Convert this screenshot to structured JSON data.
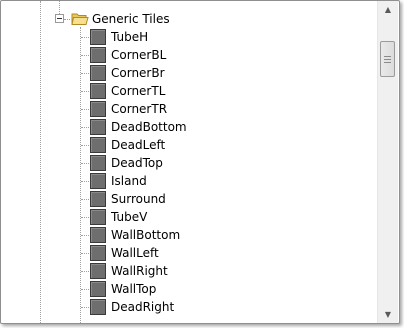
{
  "tree": {
    "root": {
      "label": "Generic Tiles",
      "icon": "folder-open-icon",
      "expanded": true
    },
    "items": [
      {
        "label": "TubeH",
        "icon": "tile-icon"
      },
      {
        "label": "CornerBL",
        "icon": "tile-icon"
      },
      {
        "label": "CornerBr",
        "icon": "tile-icon"
      },
      {
        "label": "CornerTL",
        "icon": "tile-icon"
      },
      {
        "label": "CornerTR",
        "icon": "tile-icon"
      },
      {
        "label": "DeadBottom",
        "icon": "tile-icon"
      },
      {
        "label": "DeadLeft",
        "icon": "tile-icon"
      },
      {
        "label": "DeadTop",
        "icon": "tile-icon"
      },
      {
        "label": "Island",
        "icon": "tile-icon"
      },
      {
        "label": "Surround",
        "icon": "tile-icon"
      },
      {
        "label": "TubeV",
        "icon": "tile-icon"
      },
      {
        "label": "WallBottom",
        "icon": "tile-icon"
      },
      {
        "label": "WallLeft",
        "icon": "tile-icon"
      },
      {
        "label": "WallRight",
        "icon": "tile-icon"
      },
      {
        "label": "WallTop",
        "icon": "tile-icon"
      },
      {
        "label": "DeadRight",
        "icon": "tile-icon"
      }
    ]
  },
  "colors": {
    "tile_fill": "#6e6e6e",
    "folder_yellow": "#f2d77a",
    "guide_lines": "#a0a0a0"
  }
}
